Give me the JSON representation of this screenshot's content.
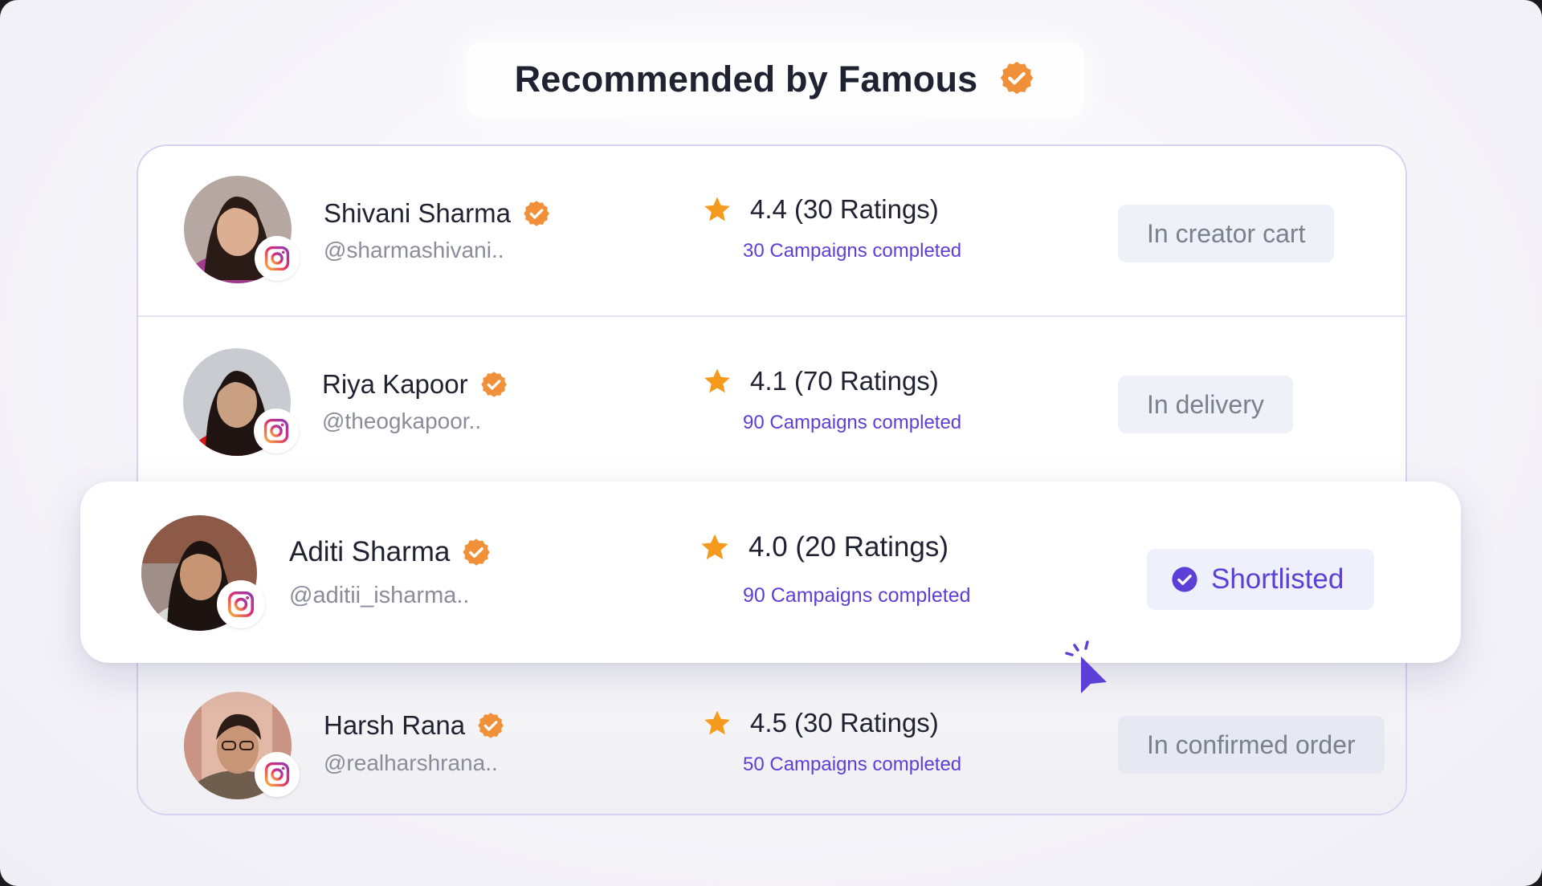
{
  "header": {
    "title": "Recommended by Famous",
    "badge_icon": "verified-badge-icon"
  },
  "colors": {
    "accent": "#5b3fd6",
    "badge": "#f0913a",
    "star": "#f59a1c",
    "instagram": "#dd2a7b"
  },
  "creators": [
    {
      "name": "Shivani Sharma",
      "handle": "@sharmashivani..",
      "rating": "4.4 (30 Ratings)",
      "campaigns": "30 Campaigns completed",
      "status": "In creator cart"
    },
    {
      "name": "Riya Kapoor",
      "handle": "@theogkapoor..",
      "rating": "4.1 (70 Ratings)",
      "campaigns": "90 Campaigns completed",
      "status": "In delivery"
    },
    {
      "name": "Aditi Sharma",
      "handle": "@aditii_isharma..",
      "rating": "4.0 (20 Ratings)",
      "campaigns": "90 Campaigns completed",
      "status": "Shortlisted"
    },
    {
      "name": "Harsh Rana",
      "handle": "@realharshrana..",
      "rating": "4.5 (30 Ratings)",
      "campaigns": "50 Campaigns completed",
      "status": "In confirmed order"
    }
  ]
}
